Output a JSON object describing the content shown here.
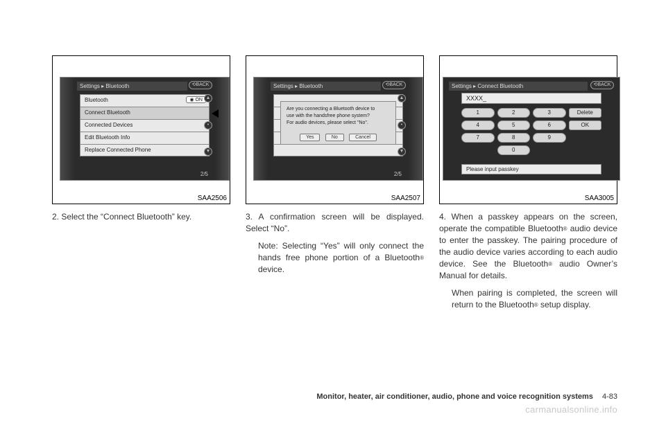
{
  "fig1": {
    "caption": "SAA2506",
    "breadcrumb": "Settings ▸ Bluetooth",
    "back": "⟲BACK",
    "on_label": "◉ ON",
    "page_indicator": "2/5",
    "items": [
      {
        "label": "Bluetooth"
      },
      {
        "label": "Connect Bluetooth"
      },
      {
        "label": "Connected Devices"
      },
      {
        "label": "Edit Bluetooth Info"
      },
      {
        "label": "Replace Connected Phone"
      }
    ]
  },
  "fig2": {
    "caption": "SAA2507",
    "breadcrumb": "Settings ▸ Bluetooth",
    "back": "⟲BACK",
    "page_indicator": "2/5",
    "dialog": {
      "line1": "Are you connecting a Bluetooth device to",
      "line2": "use with the handsfree phone system?",
      "line3": "For audio devices, please select \"No\".",
      "yes": "Yes",
      "no": "No",
      "cancel": "Cancel"
    }
  },
  "fig3": {
    "caption": "SAA3005",
    "breadcrumb": "Settings ▸ Connect Bluetooth",
    "back": "⟲BACK",
    "input_value": "XXXX_",
    "hint": "Please input passkey",
    "keys": {
      "k1": "1",
      "k2": "2",
      "k3": "3",
      "del": "Delete",
      "k4": "4",
      "k5": "5",
      "k6": "6",
      "ok": "OK",
      "k7": "7",
      "k8": "8",
      "k9": "9",
      "k0": "0"
    }
  },
  "text": {
    "step2": "2.  Select the “Connect Bluetooth” key.",
    "step3a": "3.  A confirmation screen will be displayed. Select “No”.",
    "step3b": "Note: Selecting “Yes” will only connect the hands free phone portion of a Bluetooth",
    "step3c": " device.",
    "step4a": "4.  When a passkey appears on the screen, operate the compatible Bluetooth",
    "step4b": " audio device to enter the passkey. The pairing procedure of the audio device varies according to each audio device. See the Bluetooth",
    "step4c": " audio Owner’s Manual for details.",
    "step4d": "When pairing is completed, the screen will return to the Bluetooth",
    "step4e": " setup display."
  },
  "footer": {
    "title": "Monitor, heater, air conditioner, audio, phone and voice recognition systems",
    "page": "4-83"
  },
  "watermark": "carmanualsonline.info"
}
